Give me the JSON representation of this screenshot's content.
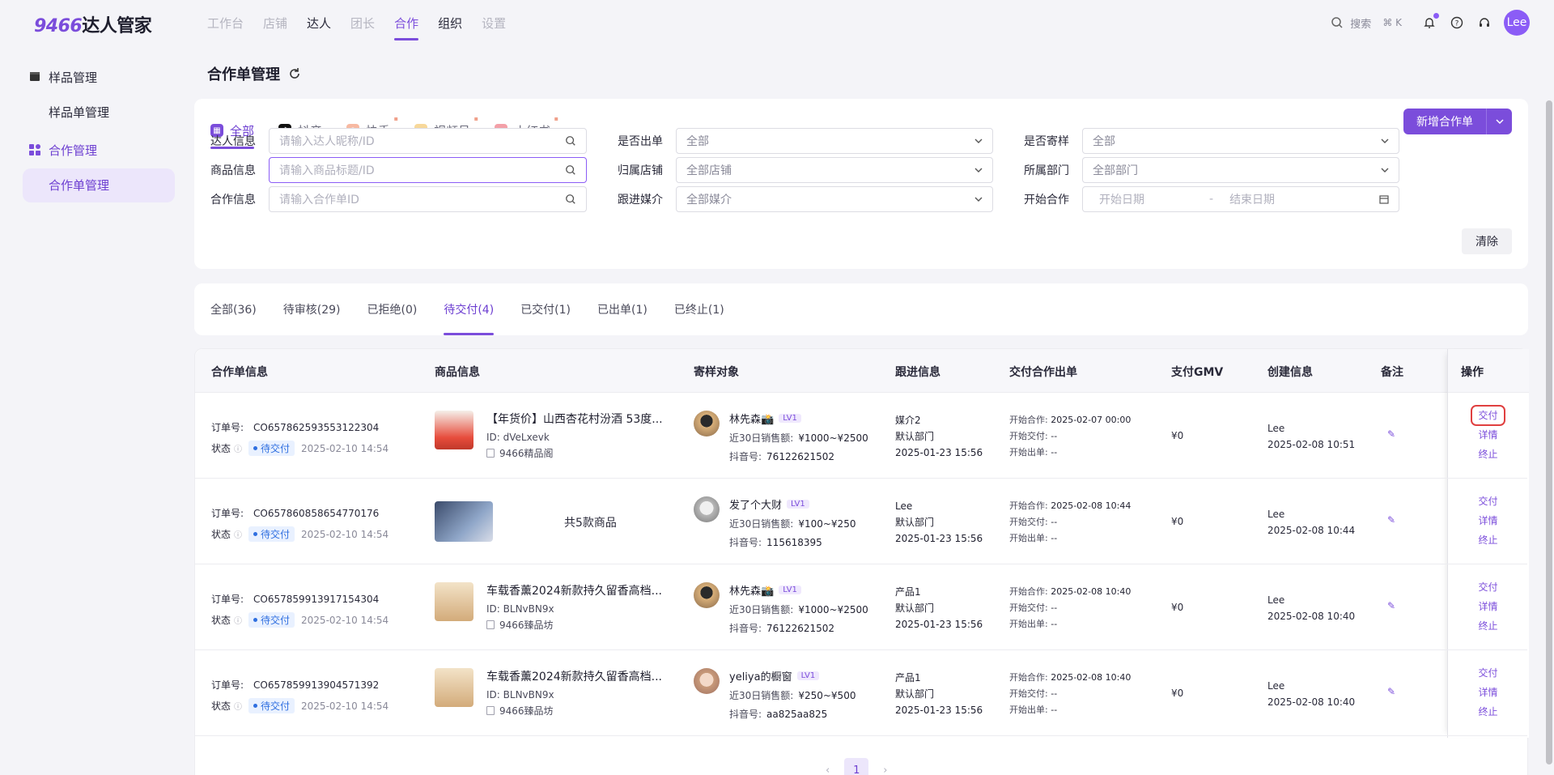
{
  "app": {
    "logo_num": "9466",
    "logo_text": "达人管家",
    "nav": [
      "工作台",
      "店铺",
      "达人",
      "团长",
      "合作",
      "组织",
      "设置"
    ],
    "search_label": "搜索",
    "search_kbd": "⌘ K",
    "avatar": "Lee"
  },
  "sidebar": {
    "group1": "样品管理",
    "item1": "样品单管理",
    "group2": "合作管理",
    "item2": "合作单管理"
  },
  "page": {
    "title": "合作单管理"
  },
  "platform_tabs": [
    "全部",
    "抖音",
    "快手",
    "视频号",
    "小红书"
  ],
  "add_button": "新增合作单",
  "filters": {
    "kol_label": "达人信息",
    "kol_placeholder": "请输入达人昵称/ID",
    "goods_label": "商品信息",
    "goods_placeholder": "请输入商品标题/ID",
    "coop_label": "合作信息",
    "coop_placeholder": "请输入合作单ID",
    "out_label": "是否出单",
    "out_value": "全部",
    "shop_label": "归属店铺",
    "shop_value": "全部店铺",
    "media_label": "跟进媒介",
    "media_value": "全部媒介",
    "sample_label": "是否寄样",
    "sample_value": "全部",
    "dept_label": "所属部门",
    "dept_value": "全部部门",
    "start_label": "开始合作",
    "start_ph": "开始日期",
    "sep": "-",
    "end_ph": "结束日期",
    "clear": "清除"
  },
  "status_tabs": [
    "全部(36)",
    "待审核(29)",
    "已拒绝(0)",
    "待交付(4)",
    "已交付(1)",
    "已出单(1)",
    "已终止(1)"
  ],
  "table": {
    "headers": [
      "合作单信息",
      "商品信息",
      "寄样对象",
      "跟进信息",
      "交付合作出单",
      "支付GMV",
      "创建信息",
      "备注",
      "操作"
    ],
    "labels": {
      "order": "订单号:",
      "status": "状态",
      "id": "ID:",
      "sales": "近30日销售额:",
      "douyin": "抖音号:",
      "start": "开始合作:",
      "deliver": "开始交付:",
      "out": "开始出单:"
    },
    "rows": [
      {
        "order_no": "CO657862593553122304",
        "status": "待交付",
        "status_time": "2025-02-10 14:54",
        "product_title": "【年货价】山西杏花村汾酒 53度...",
        "product_id": "dVeLxevk",
        "shop": "9466精品阁",
        "kol_name": "林先森📸",
        "kol_lv": "LV1",
        "kol_sales": "¥1000~¥2500",
        "kol_douyin": "76122621502",
        "fu_media": "媒介2",
        "fu_dept": "默认部门",
        "fu_time": "2025-01-23 15:56",
        "start": "2025-02-07 00:00",
        "deliver": "--",
        "out": "--",
        "gmv": "¥0",
        "creator": "Lee",
        "created": "2025-02-08 10:51",
        "ops": [
          "交付",
          "详情",
          "终止"
        ]
      },
      {
        "order_no": "CO657860858654770176",
        "status": "待交付",
        "status_time": "2025-02-10 14:54",
        "product_multi": "共5款商品",
        "kol_name": "发了个大财",
        "kol_lv": "LV1",
        "kol_sales": "¥100~¥250",
        "kol_douyin": "115618395",
        "fu_media": "Lee",
        "fu_dept": "默认部门",
        "fu_time": "2025-01-23 15:56",
        "start": "2025-02-08 10:44",
        "deliver": "--",
        "out": "--",
        "gmv": "¥0",
        "creator": "Lee",
        "created": "2025-02-08 10:44",
        "ops": [
          "交付",
          "详情",
          "终止"
        ]
      },
      {
        "order_no": "CO657859913917154304",
        "status": "待交付",
        "status_time": "2025-02-10 14:54",
        "product_title": "车载香薰2024新款持久留香高档...",
        "product_id": "BLNvBN9x",
        "shop": "9466臻品坊",
        "kol_name": "林先森📸",
        "kol_lv": "LV1",
        "kol_sales": "¥1000~¥2500",
        "kol_douyin": "76122621502",
        "fu_media": "产品1",
        "fu_dept": "默认部门",
        "fu_time": "2025-01-23 15:56",
        "start": "2025-02-08 10:40",
        "deliver": "--",
        "out": "--",
        "gmv": "¥0",
        "creator": "Lee",
        "created": "2025-02-08 10:40",
        "ops": [
          "交付",
          "详情",
          "终止"
        ]
      },
      {
        "order_no": "CO657859913904571392",
        "status": "待交付",
        "status_time": "2025-02-10 14:54",
        "product_title": "车载香薰2024新款持久留香高档...",
        "product_id": "BLNvBN9x",
        "shop": "9466臻品坊",
        "kol_name": "yeliya的橱窗",
        "kol_lv": "LV1",
        "kol_sales": "¥250~¥500",
        "kol_douyin": "aa825aa825",
        "fu_media": "产品1",
        "fu_dept": "默认部门",
        "fu_time": "2025-01-23 15:56",
        "start": "2025-02-08 10:40",
        "deliver": "--",
        "out": "--",
        "gmv": "¥0",
        "creator": "Lee",
        "created": "2025-02-08 10:40",
        "ops": [
          "交付",
          "详情",
          "终止"
        ]
      }
    ]
  },
  "pagination": {
    "prev": "‹",
    "current": "1",
    "next": "›"
  }
}
